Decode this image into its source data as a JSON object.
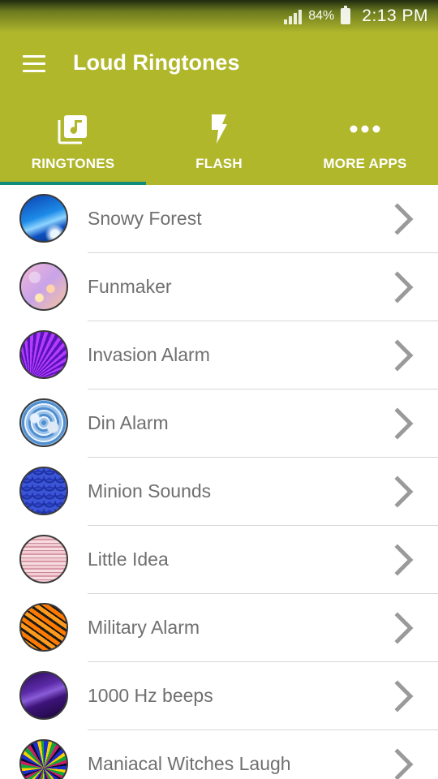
{
  "status_bar": {
    "battery_percent": "84%",
    "time": "2:13 PM",
    "icons": [
      "signal-icon",
      "battery-icon"
    ]
  },
  "app_bar": {
    "title": "Loud Ringtones",
    "menu_icon": "hamburger-menu-icon",
    "color": "#b0b72b"
  },
  "tabs": [
    {
      "label": "RINGTONES",
      "icon": "music-library-icon",
      "selected": true
    },
    {
      "label": "FLASH",
      "icon": "flash-icon",
      "selected": false
    },
    {
      "label": "MORE APPS",
      "icon": "more-dots-icon",
      "selected": false
    }
  ],
  "accent_color": "#0e8c7c",
  "ringtones": [
    {
      "name": "Snowy Forest",
      "art": "blue-swoosh"
    },
    {
      "name": "Funmaker",
      "art": "bokeh-lights"
    },
    {
      "name": "Invasion Alarm",
      "art": "purple-rays"
    },
    {
      "name": "Din Alarm",
      "art": "blue-marble"
    },
    {
      "name": "Minion Sounds",
      "art": "blue-scales"
    },
    {
      "name": "Little Idea",
      "art": "pink-wood"
    },
    {
      "name": "Military Alarm",
      "art": "tiger-stripes"
    },
    {
      "name": "1000 Hz beeps",
      "art": "purple-silk"
    },
    {
      "name": "Maniacal Witches Laugh",
      "art": "feathers"
    }
  ]
}
